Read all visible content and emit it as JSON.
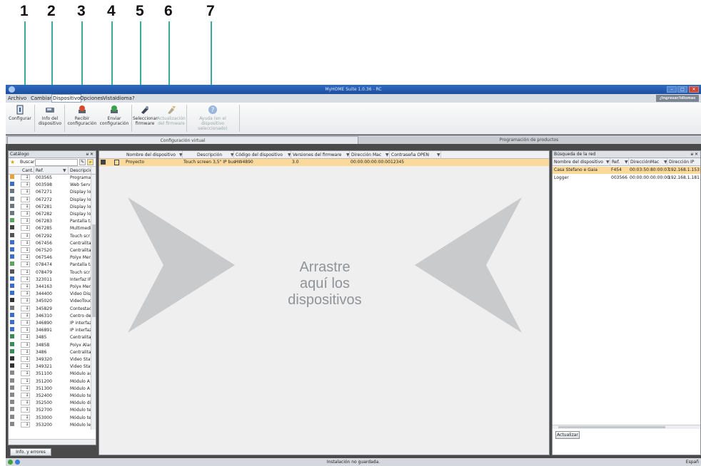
{
  "callouts": [
    "1",
    "2",
    "3",
    "4",
    "5",
    "6",
    "7"
  ],
  "window": {
    "title": "MyHOME Suite 1.0.36 - RC",
    "user_badge": "¿Ingresar/Idiomas"
  },
  "menu": [
    "Archivo",
    "Cambiar",
    "Dispositivo",
    "Opciones",
    "Vista",
    "Idioma",
    "?"
  ],
  "toolbar": {
    "configurar": "Configurar",
    "info": [
      "Info del",
      "dispositivo"
    ],
    "recibir": [
      "Recibir",
      "configuración"
    ],
    "enviar": [
      "Enviar",
      "configuración"
    ],
    "seleccionar": [
      "Seleccionar",
      "firmware"
    ],
    "actualizacion": [
      "Actualización",
      "del firmware"
    ],
    "ayuda": [
      "Ayuda (en el",
      "dispositivo seleccionado)"
    ]
  },
  "mode_tabs": [
    "Configuración virtual",
    "Programación de productos"
  ],
  "catalog": {
    "title": "Catálogo",
    "search_label": "Buscar",
    "col_qty": "Cant.",
    "col_ref": "Ref.",
    "col_desc": "Descripció",
    "rows": [
      [
        "003565",
        "Programa"
      ],
      [
        "003598",
        "Web Servi"
      ],
      [
        "067271",
        "Display lo"
      ],
      [
        "067272",
        "Display lo"
      ],
      [
        "067281",
        "Display lo"
      ],
      [
        "067282",
        "Display lo"
      ],
      [
        "067283",
        "Pantalla tá"
      ],
      [
        "067285",
        "Multimedi"
      ],
      [
        "067292",
        "Touch scr"
      ],
      [
        "067456",
        "Centralita"
      ],
      [
        "067520",
        "Centralita"
      ],
      [
        "067546",
        "Polyx Men"
      ],
      [
        "078474",
        "Pantalla tá"
      ],
      [
        "078479",
        "Touch scr"
      ],
      [
        "323011",
        "Interfaz IF"
      ],
      [
        "344163",
        "Polyx Men"
      ],
      [
        "344400",
        "Video Disp"
      ],
      [
        "345020",
        "VideoTouc"
      ],
      [
        "345829",
        "Contestad"
      ],
      [
        "346310",
        "Centro de"
      ],
      [
        "346890",
        "IP interfaz"
      ],
      [
        "346891",
        "IP interfaz"
      ],
      [
        "3485",
        "Centralita"
      ],
      [
        "3485B",
        "Polyx Alar"
      ],
      [
        "3486",
        "Centralita"
      ],
      [
        "349320",
        "Video Stat"
      ],
      [
        "349321",
        "Video Stat"
      ],
      [
        "351100",
        "Módulo au"
      ],
      [
        "351200",
        "Módulo A"
      ],
      [
        "351300",
        "Módulo A"
      ],
      [
        "352400",
        "Módulo te"
      ],
      [
        "352500",
        "Módulo di"
      ],
      [
        "352700",
        "Módulo te"
      ],
      [
        "353000",
        "Módulo te"
      ],
      [
        "353200",
        "Módulo le"
      ]
    ],
    "qty": "1",
    "info_button": "Info. y errores"
  },
  "project": {
    "columns": [
      "Nombre del dispositivo",
      "Descripción",
      "Código del dispositivo",
      "Versiones del firmware",
      "Dirección Mac",
      "Contraseña OPEN"
    ],
    "row": [
      "Proyecto",
      "Touch screen 3,5\" IP bus",
      "HW4890",
      "3.0",
      "00:00:00:00:00:00",
      "12345"
    ],
    "drop_text": [
      "Arrastre",
      "aquí los",
      "dispositivos"
    ]
  },
  "network": {
    "title": "Búsqueda de la red",
    "columns": [
      "Nombre del dispositivo",
      "Ref.",
      "DirecciónMac",
      "Dirección IP"
    ],
    "rows": [
      [
        "Casa Stefano e Gaia",
        "F454",
        "00:03:50:80:00:07",
        "192.168.1.153"
      ],
      [
        "Logger",
        "003566",
        "00:00:00:00:00:00",
        "192.168.1.181"
      ]
    ],
    "button": "Actualizar"
  },
  "status": {
    "text": "Instalación no guardada.",
    "language": "Españ"
  }
}
